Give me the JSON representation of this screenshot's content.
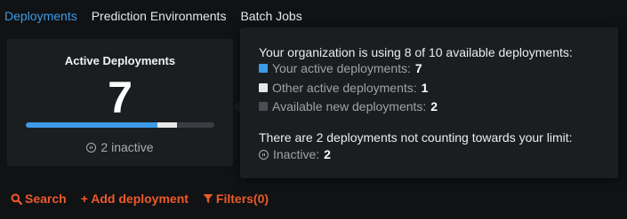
{
  "tabs": [
    {
      "label": "Deployments",
      "active": true
    },
    {
      "label": "Prediction Environments",
      "active": false
    },
    {
      "label": "Batch Jobs",
      "active": false
    }
  ],
  "card": {
    "title": "Active Deployments",
    "count": "7",
    "inactive_text": "2 inactive",
    "usage_fraction_mine": 0.7,
    "usage_fraction_other": 0.1
  },
  "tooltip": {
    "headline": "Your organization is using 8 of 10 available deployments:",
    "items": [
      {
        "label": "Your active deployments:",
        "value": "7",
        "color": "#3d9ae8"
      },
      {
        "label": "Other active deployments:",
        "value": "1",
        "color": "#e6e6e6"
      },
      {
        "label": "Available new deployments:",
        "value": "2",
        "color": "#4a4d52"
      }
    ],
    "note": "There are 2 deployments not counting towards your limit:",
    "inactive_label": "Inactive:",
    "inactive_value": "2"
  },
  "actions": {
    "search_label": "Search",
    "add_label": "+ Add deployment",
    "filters_label": "Filters(0)"
  },
  "colors": {
    "accent": "#3d9ae8",
    "action": "#ea5a2a",
    "background": "#101214",
    "panel": "#1b1e21"
  }
}
